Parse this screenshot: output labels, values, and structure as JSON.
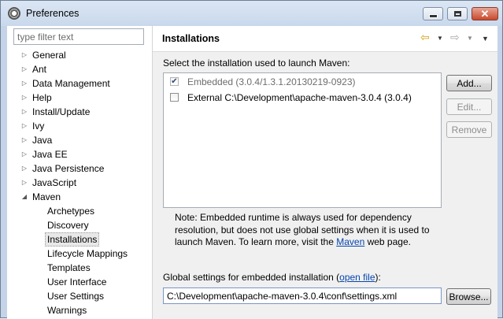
{
  "window": {
    "title": "Preferences"
  },
  "filter": {
    "placeholder": "type filter text"
  },
  "tree": [
    {
      "label": "General",
      "indent": 0,
      "expander": "collapsed"
    },
    {
      "label": "Ant",
      "indent": 0,
      "expander": "collapsed"
    },
    {
      "label": "Data Management",
      "indent": 0,
      "expander": "collapsed"
    },
    {
      "label": "Help",
      "indent": 0,
      "expander": "collapsed"
    },
    {
      "label": "Install/Update",
      "indent": 0,
      "expander": "collapsed"
    },
    {
      "label": "Ivy",
      "indent": 0,
      "expander": "collapsed"
    },
    {
      "label": "Java",
      "indent": 0,
      "expander": "collapsed"
    },
    {
      "label": "Java EE",
      "indent": 0,
      "expander": "collapsed"
    },
    {
      "label": "Java Persistence",
      "indent": 0,
      "expander": "collapsed"
    },
    {
      "label": "JavaScript",
      "indent": 0,
      "expander": "collapsed"
    },
    {
      "label": "Maven",
      "indent": 0,
      "expander": "expanded"
    },
    {
      "label": "Archetypes",
      "indent": 1,
      "expander": "none"
    },
    {
      "label": "Discovery",
      "indent": 1,
      "expander": "none"
    },
    {
      "label": "Installations",
      "indent": 1,
      "expander": "none",
      "selected": true
    },
    {
      "label": "Lifecycle Mappings",
      "indent": 1,
      "expander": "none"
    },
    {
      "label": "Templates",
      "indent": 1,
      "expander": "none"
    },
    {
      "label": "User Interface",
      "indent": 1,
      "expander": "none"
    },
    {
      "label": "User Settings",
      "indent": 1,
      "expander": "none"
    },
    {
      "label": "Warnings",
      "indent": 1,
      "expander": "none"
    }
  ],
  "page": {
    "title": "Installations",
    "section_label": "Select the installation used to launch Maven:",
    "installations": [
      {
        "label": "Embedded (3.0.4/1.3.1.20130219-0923)",
        "checked": true,
        "disabled": true
      },
      {
        "label": "External C:\\Development\\apache-maven-3.0.4 (3.0.4)",
        "checked": false,
        "disabled": false
      }
    ],
    "buttons": {
      "add": "Add...",
      "edit": "Edit...",
      "remove": "Remove",
      "browse": "Browse..."
    },
    "note": {
      "text_before": "Note: Embedded runtime is always used for dependency resolution, but does not use global settings when it is used to launch Maven. To learn more, visit the ",
      "link": "Maven",
      "text_after": " web page."
    },
    "global": {
      "label_before": "Global settings for embedded installation (",
      "link": "open file",
      "label_after": "):",
      "value": "C:\\Development\\apache-maven-3.0.4\\conf\\settings.xml"
    }
  },
  "icons": {
    "back": "arrow-left-icon",
    "forward": "arrow-right-icon",
    "menu": "chevron-down-icon"
  }
}
